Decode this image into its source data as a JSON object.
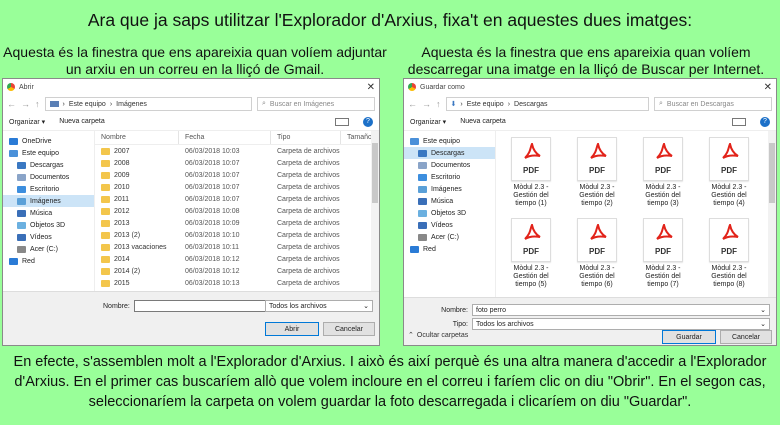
{
  "heading": "Ara que ja saps utilitzar l'Explorador d'Arxius, fixa't en aquestes dues imatges:",
  "caption_left": "Aquesta és la finestra que ens apareixia quan volíem adjuntar un arxiu en un correu en la lliçó de Gmail.",
  "caption_right": "Aquesta és la finestra que ens apareixia quan volíem descarregar una imatge en la lliçó de Buscar per Internet.",
  "footer": "En efecte, s'assemblen molt a l'Explorador d'Arxius. I això és així perquè és una altra manera d'accedir a l'Explorador d'Arxius. En el primer cas buscaríem allò que volem incloure en el correu i faríem clic on diu \"Obrir\". En el segon cas, seleccionaríem la carpeta on volem guardar la foto descarregada i clicaríem on diu \"Guardar\".",
  "open_dialog": {
    "title": "Abrir",
    "breadcrumb": [
      "Este equipo",
      "Imágenes"
    ],
    "search_placeholder": "Buscar en Imágenes",
    "toolbar": {
      "organize": "Organizar ▾",
      "new_folder": "Nueva carpeta"
    },
    "sidebar": [
      {
        "label": "OneDrive",
        "icon": "cloud-icon",
        "color": "#2a7bd6",
        "sub": false,
        "selected": false
      },
      {
        "label": "Este equipo",
        "icon": "computer-icon",
        "color": "#4a90d9",
        "sub": false,
        "selected": false
      },
      {
        "label": "Descargas",
        "icon": "download-icon",
        "color": "#3a78c2",
        "sub": true,
        "selected": false
      },
      {
        "label": "Documentos",
        "icon": "documents-icon",
        "color": "#8aa4c8",
        "sub": true,
        "selected": false
      },
      {
        "label": "Escritorio",
        "icon": "desktop-icon",
        "color": "#3c8ede",
        "sub": true,
        "selected": false
      },
      {
        "label": "Imágenes",
        "icon": "pictures-icon",
        "color": "#5aa0d8",
        "sub": true,
        "selected": true
      },
      {
        "label": "Música",
        "icon": "music-icon",
        "color": "#3a6fb8",
        "sub": true,
        "selected": false
      },
      {
        "label": "Objetos 3D",
        "icon": "objects3d-icon",
        "color": "#6bb0e0",
        "sub": true,
        "selected": false
      },
      {
        "label": "Vídeos",
        "icon": "videos-icon",
        "color": "#3a6fb8",
        "sub": true,
        "selected": false
      },
      {
        "label": "Acer (C:)",
        "icon": "drive-icon",
        "color": "#888888",
        "sub": true,
        "selected": false
      },
      {
        "label": "Red",
        "icon": "network-icon",
        "color": "#2a7bd6",
        "sub": false,
        "selected": false
      }
    ],
    "columns": [
      "Nombre",
      "Fecha",
      "Tipo",
      "Tamaño"
    ],
    "rows": [
      {
        "name": "2007",
        "date": "06/03/2018 10:03",
        "type": "Carpeta de archivos"
      },
      {
        "name": "2008",
        "date": "06/03/2018 10:07",
        "type": "Carpeta de archivos"
      },
      {
        "name": "2009",
        "date": "06/03/2018 10:07",
        "type": "Carpeta de archivos"
      },
      {
        "name": "2010",
        "date": "06/03/2018 10:07",
        "type": "Carpeta de archivos"
      },
      {
        "name": "2011",
        "date": "06/03/2018 10:07",
        "type": "Carpeta de archivos"
      },
      {
        "name": "2012",
        "date": "06/03/2018 10:08",
        "type": "Carpeta de archivos"
      },
      {
        "name": "2013",
        "date": "06/03/2018 10:09",
        "type": "Carpeta de archivos"
      },
      {
        "name": "2013 (2)",
        "date": "06/03/2018 10:10",
        "type": "Carpeta de archivos"
      },
      {
        "name": "2013 vacaciones",
        "date": "06/03/2018 10:11",
        "type": "Carpeta de archivos"
      },
      {
        "name": "2014",
        "date": "06/03/2018 10:12",
        "type": "Carpeta de archivos"
      },
      {
        "name": "2014 (2)",
        "date": "06/03/2018 10:12",
        "type": "Carpeta de archivos"
      },
      {
        "name": "2015",
        "date": "06/03/2018 10:13",
        "type": "Carpeta de archivos"
      }
    ],
    "filename_label": "Nombre:",
    "filename_value": "",
    "filter_value": "Todos los archivos",
    "open_button": "Abrir",
    "cancel_button": "Cancelar"
  },
  "save_dialog": {
    "title": "Guardar como",
    "breadcrumb": [
      "Este equipo",
      "Descargas"
    ],
    "search_placeholder": "Buscar en Descargas",
    "toolbar": {
      "organize": "Organizar ▾",
      "new_folder": "Nueva carpeta"
    },
    "sidebar": [
      {
        "label": "Este equipo",
        "icon": "computer-icon",
        "color": "#4a90d9",
        "sub": false,
        "selected": false
      },
      {
        "label": "Descargas",
        "icon": "download-icon",
        "color": "#3a78c2",
        "sub": true,
        "selected": true
      },
      {
        "label": "Documentos",
        "icon": "documents-icon",
        "color": "#8aa4c8",
        "sub": true,
        "selected": false
      },
      {
        "label": "Escritorio",
        "icon": "desktop-icon",
        "color": "#3c8ede",
        "sub": true,
        "selected": false
      },
      {
        "label": "Imágenes",
        "icon": "pictures-icon",
        "color": "#5aa0d8",
        "sub": true,
        "selected": false
      },
      {
        "label": "Música",
        "icon": "music-icon",
        "color": "#3a6fb8",
        "sub": true,
        "selected": false
      },
      {
        "label": "Objetos 3D",
        "icon": "objects3d-icon",
        "color": "#6bb0e0",
        "sub": true,
        "selected": false
      },
      {
        "label": "Vídeos",
        "icon": "videos-icon",
        "color": "#3a6fb8",
        "sub": true,
        "selected": false
      },
      {
        "label": "Acer (C:)",
        "icon": "drive-icon",
        "color": "#888888",
        "sub": true,
        "selected": false
      },
      {
        "label": "Red",
        "icon": "network-icon",
        "color": "#2a7bd6",
        "sub": false,
        "selected": false
      }
    ],
    "files": [
      {
        "name": "Mòdul 2.3 - Gestión del tiempo (1)"
      },
      {
        "name": "Mòdul 2.3 - Gestión del tiempo (2)"
      },
      {
        "name": "Mòdul 2.3 - Gestión del tiempo (3)"
      },
      {
        "name": "Mòdul 2.3 - Gestión del tiempo (4)"
      },
      {
        "name": "Mòdul 2.3 - Gestión del tiempo (5)"
      },
      {
        "name": "Mòdul 2.3 - Gestión del tiempo (6)"
      },
      {
        "name": "Mòdul 2.3 - Gestión del tiempo (7)"
      },
      {
        "name": "Mòdul 2.3 - Gestión del tiempo (8)"
      }
    ],
    "pdf_label": "PDF",
    "filename_label": "Nombre:",
    "filename_value": "foto perro",
    "type_label": "Tipo:",
    "type_value": "Todos los archivos",
    "hide_folders": "Ocultar carpetas",
    "save_button": "Guardar",
    "cancel_button": "Cancelar"
  },
  "colors": {
    "background": "#99ff99",
    "folder": "#f3c64c",
    "pdf_red": "#e2231a",
    "selected": "#cce4f7",
    "accent": "#0078d7"
  }
}
